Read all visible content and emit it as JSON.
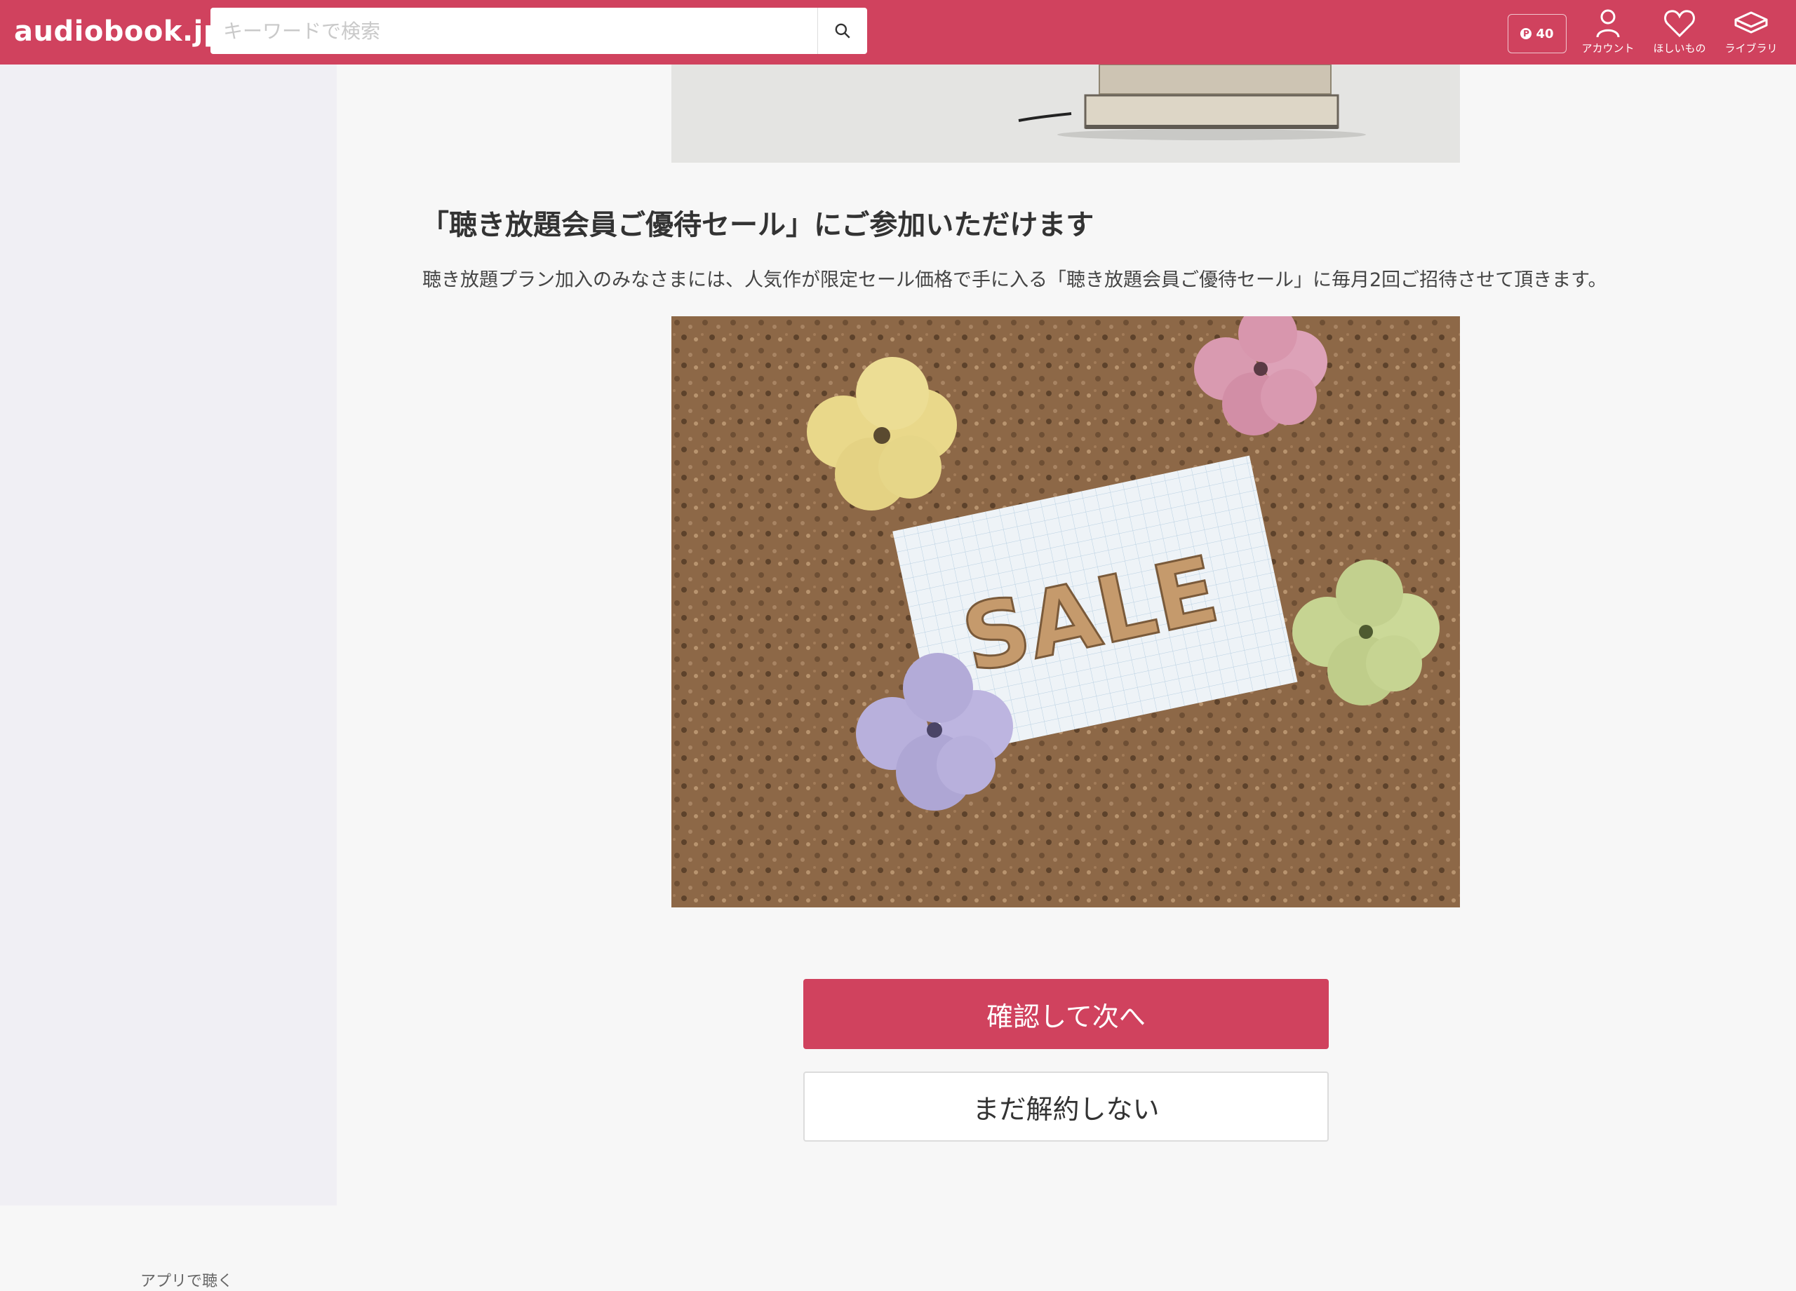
{
  "header": {
    "logo": "audiobook.jp",
    "search_placeholder": "キーワードで検索",
    "points": "40",
    "nav": [
      {
        "label": "アカウント",
        "icon": "account-icon"
      },
      {
        "label": "ほしいもの",
        "icon": "heart-icon"
      },
      {
        "label": "ライブラリ",
        "icon": "library-icon"
      }
    ]
  },
  "main": {
    "heading": "「聴き放題会員ご優待セール」にご参加いただけます",
    "description": "聴き放題プラン加入のみなさまには、人気作が限定セール価格で手に入る「聴き放題会員ご優待セール」に毎月2回ご招待させて頂きます。",
    "sale_image_text": "SALE",
    "confirm_button": "確認して次へ",
    "cancel_button": "まだ解約しない"
  },
  "footer": {
    "app_link": "アプリで聴く"
  },
  "colors": {
    "brand": "#d0425e",
    "sidebar_bg": "#f0eff4",
    "page_bg": "#f7f7f7"
  }
}
